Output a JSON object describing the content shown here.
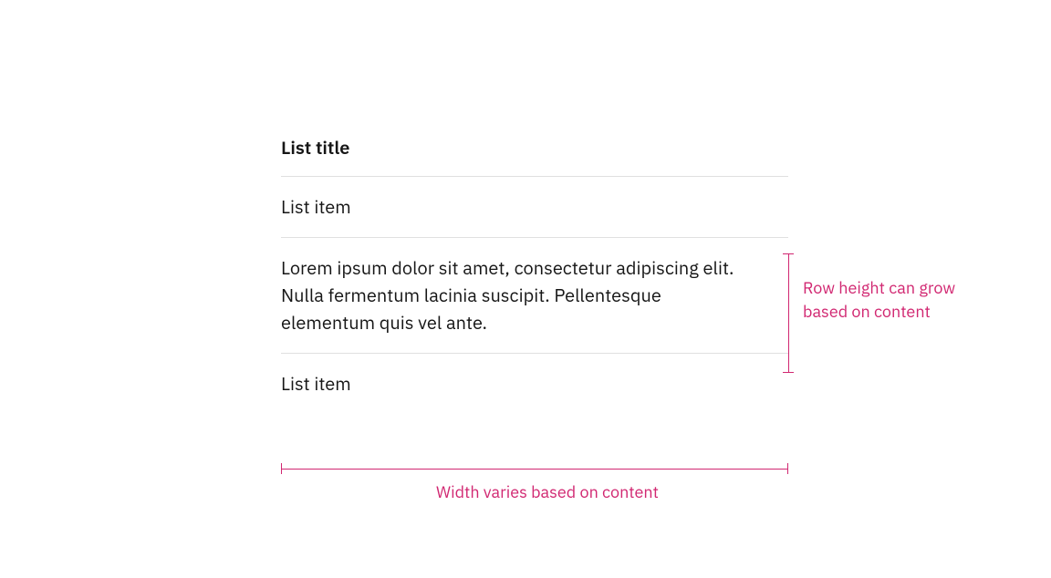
{
  "list": {
    "title": "List title",
    "items": [
      "List item",
      "Lorem ipsum dolor sit amet, consectetur adipiscing elit. Nulla fermentum lacinia suscipit. Pellentesque elementum quis vel ante.",
      "List item"
    ]
  },
  "annotations": {
    "row_height": "Row height can grow based on content",
    "width": "Width varies based on content"
  },
  "colors": {
    "accent": "#d12771",
    "text": "#161616",
    "divider": "#e0e0e0"
  }
}
